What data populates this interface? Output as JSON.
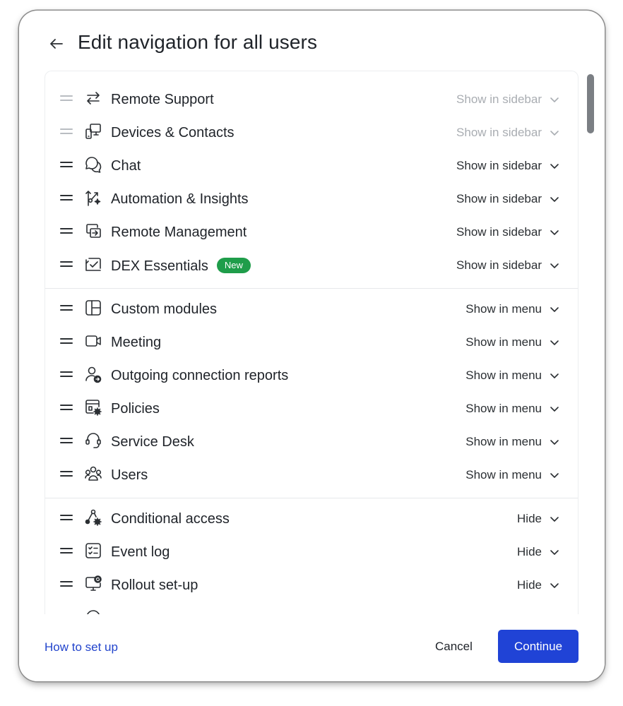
{
  "dialog": {
    "title": "Edit navigation for all users",
    "back_icon": "arrow-left-icon"
  },
  "sections": [
    {
      "items": [
        {
          "label": "Remote Support",
          "icon": "arrows-exchange-icon",
          "visibility": "Show in sidebar",
          "dimmed": true
        },
        {
          "label": "Devices & Contacts",
          "icon": "devices-icon",
          "visibility": "Show in sidebar",
          "dimmed": true
        },
        {
          "label": "Chat",
          "icon": "chat-bubbles-icon",
          "visibility": "Show in sidebar",
          "dimmed": false
        },
        {
          "label": "Automation & Insights",
          "icon": "automation-sparkle-icon",
          "visibility": "Show in sidebar",
          "dimmed": false
        },
        {
          "label": "Remote Management",
          "icon": "remote-management-icon",
          "visibility": "Show in sidebar",
          "dimmed": false
        },
        {
          "label": "DEX Essentials",
          "icon": "chart-check-icon",
          "visibility": "Show in sidebar",
          "dimmed": false,
          "badge": "New"
        }
      ]
    },
    {
      "items": [
        {
          "label": "Custom modules",
          "icon": "layout-modules-icon",
          "visibility": "Show in menu"
        },
        {
          "label": "Meeting",
          "icon": "video-camera-icon",
          "visibility": "Show in menu"
        },
        {
          "label": "Outgoing connection reports",
          "icon": "user-arrow-icon",
          "visibility": "Show in menu"
        },
        {
          "label": "Policies",
          "icon": "policy-gear-icon",
          "visibility": "Show in menu"
        },
        {
          "label": "Service Desk",
          "icon": "headset-icon",
          "visibility": "Show in menu"
        },
        {
          "label": "Users",
          "icon": "users-group-icon",
          "visibility": "Show in menu"
        }
      ]
    },
    {
      "items": [
        {
          "label": "Conditional access",
          "icon": "branch-gear-icon",
          "visibility": "Hide"
        },
        {
          "label": "Event log",
          "icon": "checklist-icon",
          "visibility": "Hide"
        },
        {
          "label": "Rollout set-up",
          "icon": "monitor-rollout-icon",
          "visibility": "Hide"
        }
      ]
    }
  ],
  "footer": {
    "help_link": "How to set up",
    "cancel_label": "Cancel",
    "continue_label": "Continue"
  },
  "colors": {
    "primary": "#2043d6",
    "link": "#2244cc",
    "badge_green": "#1f9d4a",
    "dimmed_text": "#a9adb2"
  }
}
